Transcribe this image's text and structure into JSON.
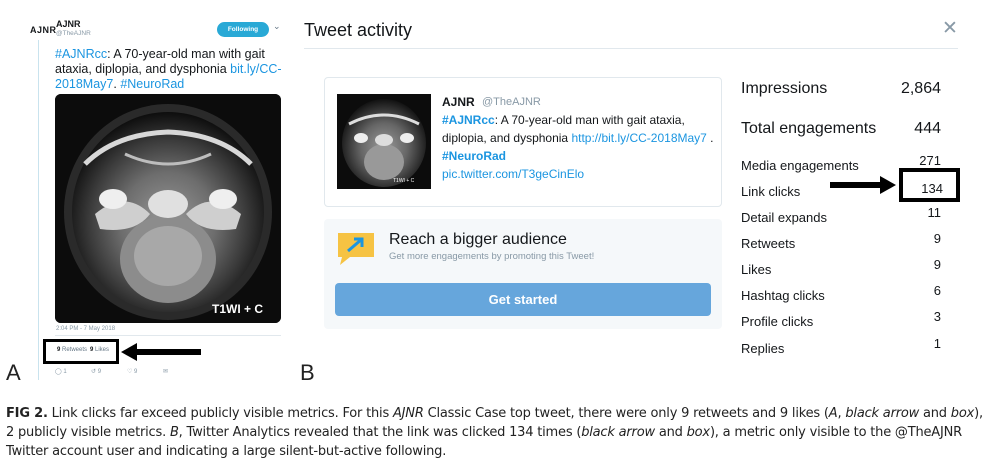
{
  "panel_a": {
    "panel_label": "A",
    "logo_text": "AJNR",
    "account_name": "AJNR",
    "account_handle": "@TheAJNR",
    "follow_button": "Following",
    "tweet_hashtag": "#AJNRcc",
    "tweet_text": ": A 70-year-old man with gait ataxia, diplopia, and dysphonia",
    "tweet_link": "bit.ly/CC-2018May7",
    "tweet_tag": "#NeuroRad",
    "image_overlay": "T1WI + C",
    "timestamp": "2:04 PM - 7 May 2018",
    "retweets_count": "9",
    "retweets_label": "Retweets",
    "likes_count": "9",
    "likes_label": "Likes",
    "action_reply_count": "1",
    "action_retweet_count": "9",
    "action_like_count": "9"
  },
  "panel_b": {
    "panel_label": "B",
    "title": "Tweet activity",
    "card": {
      "name": "AJNR",
      "handle": "@TheAJNR",
      "text_tag1": "#AJNRcc",
      "text_body": ": A 70-year-old man with gait ataxia, diplopia, and dysphonia ",
      "text_link": "http://bit.ly/CC-2018May7",
      "text_sep": " . ",
      "text_tag2": "#NeuroRad",
      "pic_link": "pic.twitter.com/T3geCinElo",
      "thumb_overlay": "T1WI + C"
    },
    "promo": {
      "title": "Reach a bigger audience",
      "subtitle": "Get more engagements by promoting this Tweet!",
      "button": "Get started"
    },
    "stats": [
      {
        "label": "Impressions",
        "value": "2,864"
      },
      {
        "label": "Total engagements",
        "value": "444"
      },
      {
        "label": "Media engagements",
        "value": "271"
      },
      {
        "label": "Link clicks",
        "value": "134"
      },
      {
        "label": "Detail expands",
        "value": "11"
      },
      {
        "label": "Retweets",
        "value": "9"
      },
      {
        "label": "Likes",
        "value": "9"
      },
      {
        "label": "Hashtag clicks",
        "value": "6"
      },
      {
        "label": "Profile clicks",
        "value": "3"
      },
      {
        "label": "Replies",
        "value": "1"
      }
    ]
  },
  "caption": {
    "fig": "FIG 2.",
    "t1": " Link clicks far exceed publicly visible metrics. For this ",
    "journal": "AJNR",
    "t2": " Classic Case top tweet, there were only 9 retweets and 9 likes (",
    "a_letter": "A",
    "t3": ", ",
    "a_note": "black arrow",
    "t4": " and ",
    "a_box": "box",
    "t5": "), 2 publicly visible metrics. ",
    "b_letter": "B",
    "t6": ", Twitter Analytics revealed that the link was clicked 134 times (",
    "b_note": "black arrow",
    "t7": " and ",
    "b_box": "box",
    "t8": "), a metric only visible to the @TheAJNR Twitter account user and indicating a large silent-but-active following."
  }
}
